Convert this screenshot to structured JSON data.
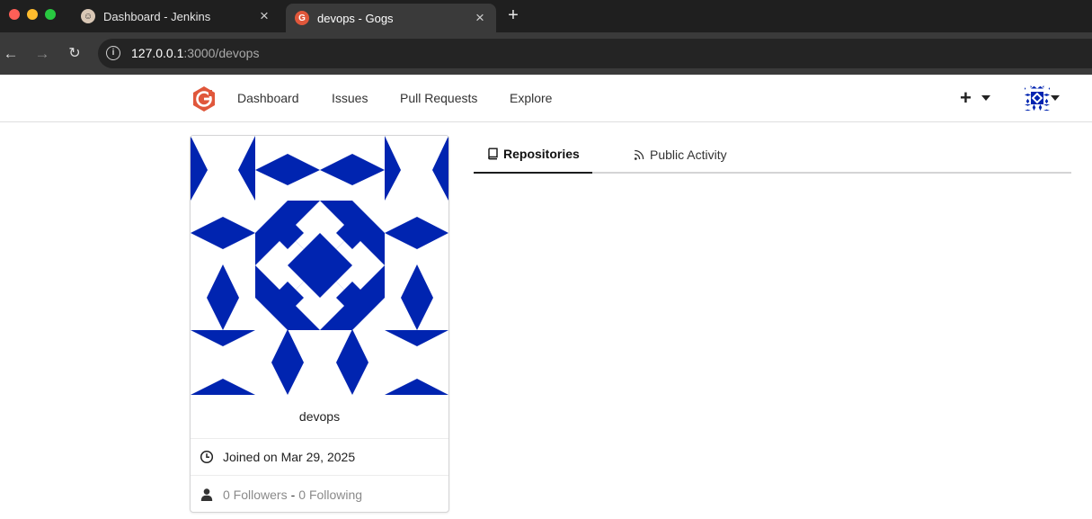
{
  "browser": {
    "tabs": [
      {
        "title": "Dashboard - Jenkins",
        "favicon": "jenkins-icon",
        "active": false
      },
      {
        "title": "devops - Gogs",
        "favicon": "gogs-icon",
        "active": true
      }
    ],
    "close_glyph": "×",
    "new_tab_glyph": "+",
    "url_host": "127.0.0.1",
    "url_path": ":3000/devops"
  },
  "header": {
    "nav": {
      "dashboard": "Dashboard",
      "issues": "Issues",
      "pulls": "Pull Requests",
      "explore": "Explore"
    },
    "create_glyph": "+"
  },
  "profile": {
    "username": "devops",
    "joined": "Joined on Mar 29, 2025",
    "followers": "0 Followers",
    "separator": "-",
    "following": "0 Following",
    "avatar_color": "#0024b0"
  },
  "tabs": {
    "repositories": "Repositories",
    "public_activity": "Public Activity"
  },
  "colors": {
    "gogs_brand": "#e0573b",
    "identicon_blue": "#0024b0"
  }
}
